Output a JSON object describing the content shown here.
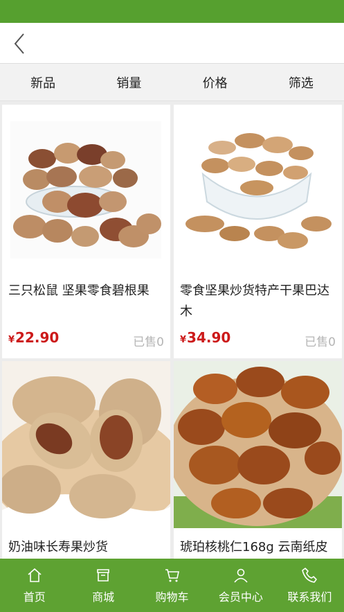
{
  "header": {
    "back_icon": "chevron-left-icon"
  },
  "sort_tabs": [
    {
      "label": "新品"
    },
    {
      "label": "销量"
    },
    {
      "label": "价格"
    },
    {
      "label": "筛选"
    }
  ],
  "products": [
    {
      "title": "三只松鼠 坚果零食碧根果",
      "currency": "¥",
      "price": "22.90",
      "sold": "已售0",
      "image": "pecans-in-glass-bowl"
    },
    {
      "title": "零食坚果炒货特产干果巴达木",
      "currency": "¥",
      "price": "34.90",
      "sold": "已售0",
      "image": "almonds-in-glass-bowl"
    },
    {
      "title": "奶油味长寿果炒货",
      "image": "pecans-on-wooden-plate"
    },
    {
      "title": "琥珀核桃仁168g 云南纸皮",
      "image": "amber-walnuts-in-bowl"
    }
  ],
  "tabbar": [
    {
      "label": "首页",
      "icon": "home-icon"
    },
    {
      "label": "商城",
      "icon": "store-icon"
    },
    {
      "label": "购物车",
      "icon": "cart-icon"
    },
    {
      "label": "会员中心",
      "icon": "user-icon"
    },
    {
      "label": "联系我们",
      "icon": "phone-icon"
    }
  ],
  "colors": {
    "brand_green": "#5ea232",
    "price_red": "#cc1a1a",
    "sold_gray": "#b5b5b5"
  }
}
